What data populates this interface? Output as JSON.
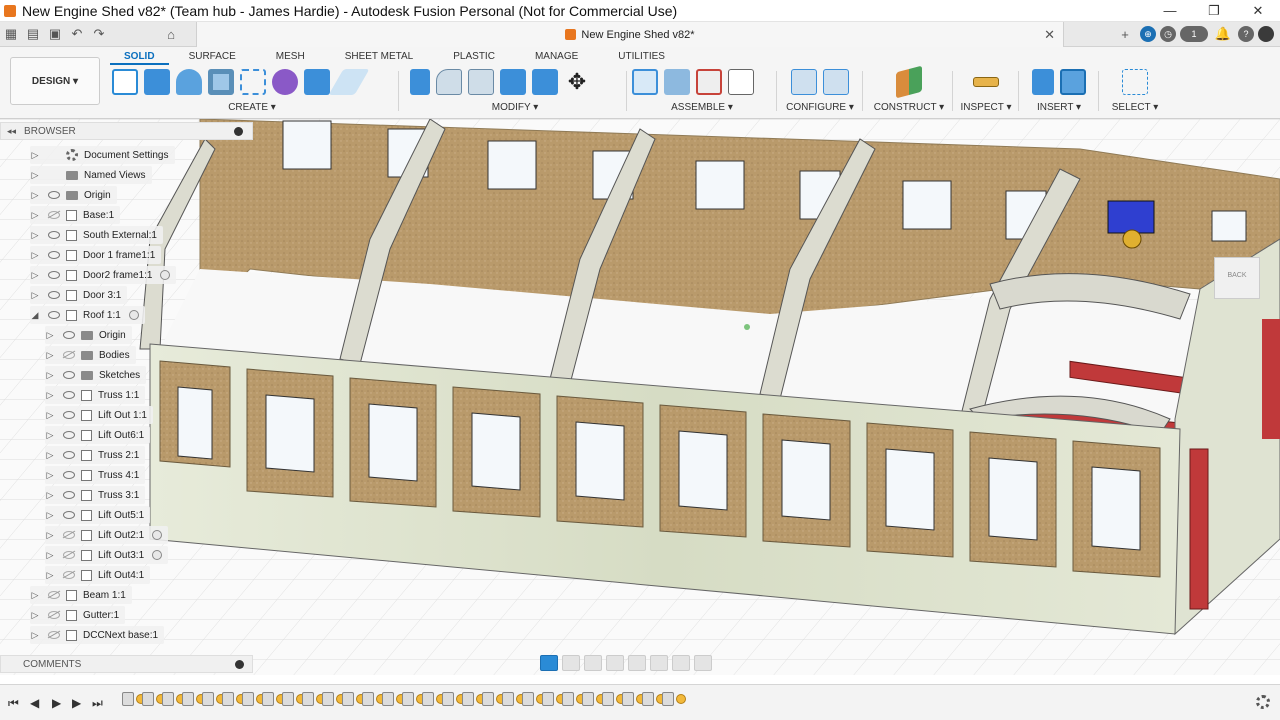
{
  "window": {
    "title": "New Engine Shed v82* (Team hub - James  Hardie) - Autodesk Fusion Personal (Not for Commercial Use)",
    "controls": [
      "—",
      "❐",
      "✕"
    ]
  },
  "document_tab": {
    "label": "New Engine Shed v82*",
    "close": "✕"
  },
  "qat": {
    "badge_count": "1"
  },
  "ribbon": {
    "tabs": [
      "SOLID",
      "SURFACE",
      "MESH",
      "SHEET METAL",
      "PLASTIC",
      "MANAGE",
      "UTILITIES"
    ],
    "active_tab": "SOLID",
    "design_button": "DESIGN ▾",
    "groups": [
      "CREATE ▾",
      "MODIFY ▾",
      "ASSEMBLE ▾",
      "CONFIGURE ▾",
      "CONSTRUCT ▾",
      "INSPECT ▾",
      "INSERT ▾",
      "SELECT ▾"
    ]
  },
  "browser": {
    "header": "BROWSER",
    "items": [
      {
        "label": "Document Settings",
        "icon": "gear-icon"
      },
      {
        "label": "Named Views",
        "icon": "folder-icon"
      },
      {
        "label": "Origin",
        "icon": "folder-icon"
      },
      {
        "label": "Base:1",
        "icon": "component-icon"
      },
      {
        "label": "South External:1",
        "icon": "component-icon"
      },
      {
        "label": "Door 1 frame1:1",
        "icon": "component-icon"
      },
      {
        "label": "Door2 frame1:1",
        "icon": "component-icon"
      },
      {
        "label": "Door 3:1",
        "icon": "component-icon"
      },
      {
        "label": "Roof 1:1",
        "icon": "component-icon"
      },
      {
        "label": "Origin",
        "icon": "folder-icon"
      },
      {
        "label": "Bodies",
        "icon": "folder-icon"
      },
      {
        "label": "Sketches",
        "icon": "folder-icon"
      },
      {
        "label": "Truss 1:1",
        "icon": "component-icon"
      },
      {
        "label": "Lift Out 1:1",
        "icon": "component-icon"
      },
      {
        "label": "Lift Out6:1",
        "icon": "component-icon"
      },
      {
        "label": "Truss 2:1",
        "icon": "component-icon"
      },
      {
        "label": "Truss 4:1",
        "icon": "component-icon"
      },
      {
        "label": "Truss 3:1",
        "icon": "component-icon"
      },
      {
        "label": "Lift Out5:1",
        "icon": "component-icon"
      },
      {
        "label": "Lift Out2:1",
        "icon": "component-icon"
      },
      {
        "label": "Lift Out3:1",
        "icon": "component-icon"
      },
      {
        "label": "Lift Out4:1",
        "icon": "component-icon"
      },
      {
        "label": "Beam 1:1",
        "icon": "component-icon"
      },
      {
        "label": "Gutter:1",
        "icon": "component-icon"
      },
      {
        "label": "DCCNext base:1",
        "icon": "component-icon"
      }
    ]
  },
  "comments": {
    "label": "COMMENTS"
  },
  "viewcube": {
    "label": "BACK"
  },
  "colors": {
    "accent": "#0a6fbe",
    "wall_brown": "#b99a6b",
    "window_white": "#f4f8fb",
    "rail_red": "#c0393a",
    "timeline_feature": "#f2b93b"
  }
}
